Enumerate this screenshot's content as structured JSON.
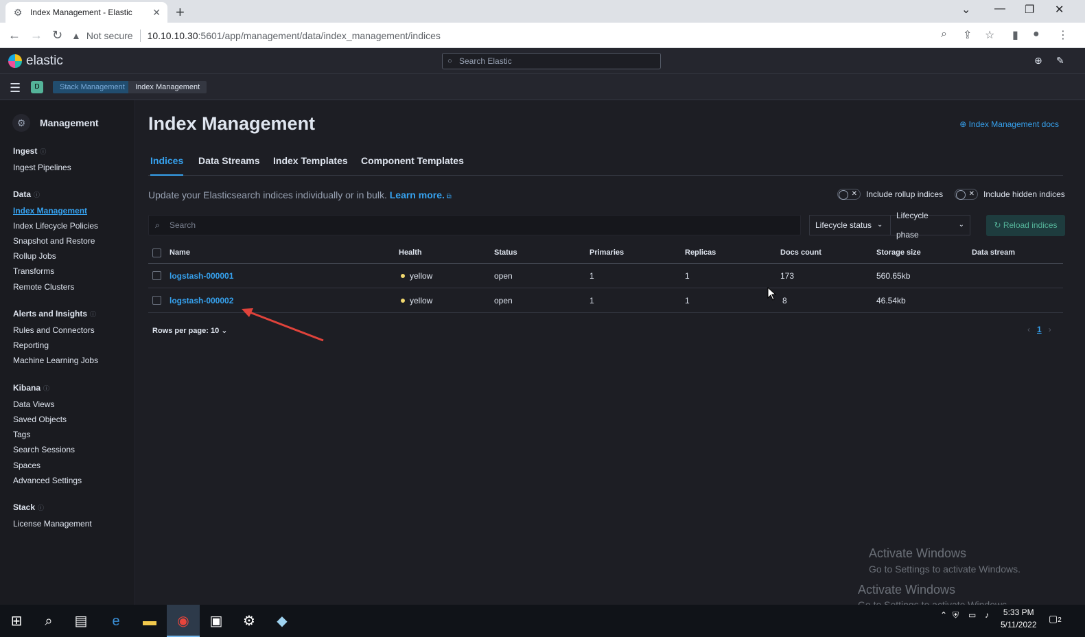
{
  "browser": {
    "tab_title": "Index Management - Elastic",
    "not_secure": "Not secure",
    "url_host": "10.10.10.30",
    "url_path": ":5601/app/management/data/index_management/indices"
  },
  "header": {
    "logo_text": "elastic",
    "search_placeholder": "Search Elastic",
    "space_letter": "D",
    "breadcrumbs": [
      "Stack Management",
      "Index Management"
    ]
  },
  "sidebar": {
    "title": "Management",
    "sections": [
      {
        "label": "Ingest",
        "items": [
          "Ingest Pipelines"
        ]
      },
      {
        "label": "Data",
        "items": [
          "Index Management",
          "Index Lifecycle Policies",
          "Snapshot and Restore",
          "Rollup Jobs",
          "Transforms",
          "Remote Clusters"
        ]
      },
      {
        "label": "Alerts and Insights",
        "items": [
          "Rules and Connectors",
          "Reporting",
          "Machine Learning Jobs"
        ]
      },
      {
        "label": "Kibana",
        "items": [
          "Data Views",
          "Saved Objects",
          "Tags",
          "Search Sessions",
          "Spaces",
          "Advanced Settings"
        ]
      },
      {
        "label": "Stack",
        "items": [
          "License Management"
        ]
      }
    ]
  },
  "main": {
    "title": "Index Management",
    "docs_link": "Index Management docs",
    "tabs": [
      "Indices",
      "Data Streams",
      "Index Templates",
      "Component Templates"
    ],
    "description": "Update your Elasticsearch indices individually or in bulk.",
    "learn_more": "Learn more.",
    "toggle_rollup": "Include rollup indices",
    "toggle_hidden": "Include hidden indices",
    "search_placeholder": "Search",
    "filter_lifecycle_status": "Lifecycle status",
    "filter_lifecycle_phase": "Lifecycle phase",
    "reload_button": "Reload indices",
    "columns": [
      "Name",
      "Health",
      "Status",
      "Primaries",
      "Replicas",
      "Docs count",
      "Storage size",
      "Data stream"
    ],
    "rows": [
      {
        "name": "logstash-000001",
        "health": "yellow",
        "status": "open",
        "primaries": "1",
        "replicas": "1",
        "docs_count": "173",
        "storage_size": "560.65kb",
        "data_stream": ""
      },
      {
        "name": "logstash-000002",
        "health": "yellow",
        "status": "open",
        "primaries": "1",
        "replicas": "1",
        "docs_count": "8",
        "storage_size": "46.54kb",
        "data_stream": ""
      }
    ],
    "rows_per_page": "Rows per page: 10",
    "current_page": "1"
  },
  "watermark": {
    "title": "Activate Windows",
    "subtitle": "Go to Settings to activate Windows."
  },
  "taskbar": {
    "time": "5:33 PM",
    "date": "5/11/2022",
    "notification_count": "2"
  },
  "colors": {
    "accent": "#36a2ef",
    "health_yellow": "#f1d86f",
    "reload_green": "#54b399"
  }
}
